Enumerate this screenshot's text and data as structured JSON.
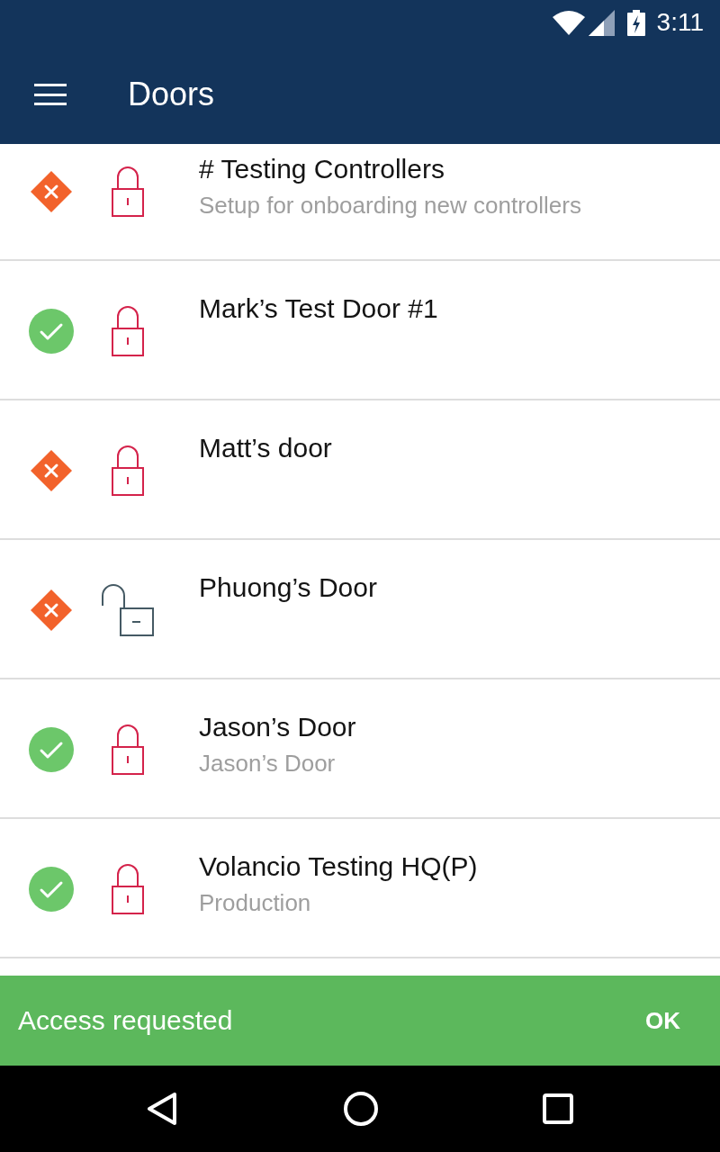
{
  "status_bar": {
    "time": "3:11"
  },
  "app_bar": {
    "title": "Doors"
  },
  "doors": [
    {
      "name": "# Testing Controllers",
      "description": "Setup for onboarding new controllers",
      "status_ok": false,
      "locked": true
    },
    {
      "name": "Mark’s Test Door #1",
      "status_ok": true,
      "locked": true
    },
    {
      "name": "Matt’s door",
      "status_ok": false,
      "locked": true
    },
    {
      "name": "Phuong’s Door",
      "status_ok": false,
      "locked": false
    },
    {
      "name": "Jason’s Door",
      "description": "Jason’s Door",
      "status_ok": true,
      "locked": true
    },
    {
      "name": "Volancio Testing HQ(P)",
      "description": "Production",
      "status_ok": true,
      "locked": true
    }
  ],
  "snackbar": {
    "message": "Access requested",
    "action": "OK"
  }
}
